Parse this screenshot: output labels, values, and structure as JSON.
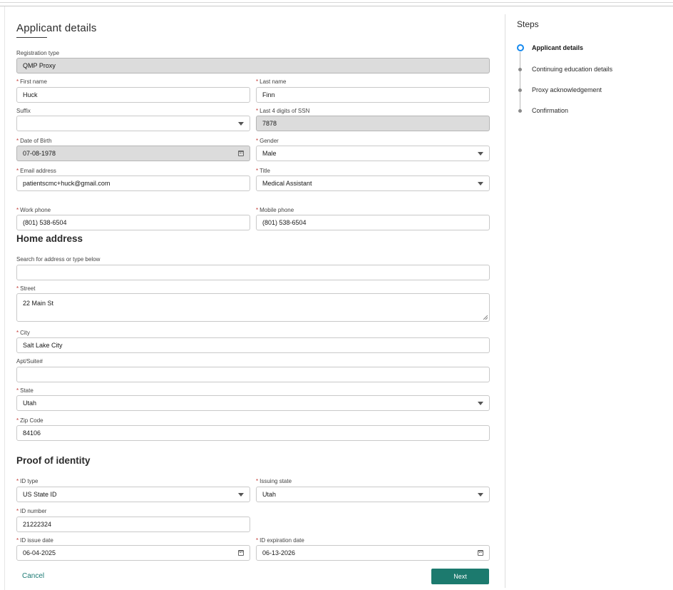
{
  "page": {
    "title": "Applicant details"
  },
  "form": {
    "registration_type": {
      "label": "Registration type",
      "value": "QMP Proxy"
    },
    "first_name": {
      "label": "First name",
      "value": "Huck"
    },
    "last_name": {
      "label": "Last name",
      "value": "Finn"
    },
    "suffix": {
      "label": "Suffix",
      "value": ""
    },
    "ssn_last4": {
      "label": "Last 4 digits of SSN",
      "value": "7878"
    },
    "dob": {
      "label": "Date of Birth",
      "value": "07-08-1978"
    },
    "gender": {
      "label": "Gender",
      "value": "Male"
    },
    "email": {
      "label": "Email address",
      "value": "patientscmc+huck@gmail.com"
    },
    "title_field": {
      "label": "Title",
      "value": "Medical Assistant"
    },
    "work_phone": {
      "label": "Work phone",
      "value": "(801) 538-6504"
    },
    "mobile_phone": {
      "label": "Mobile phone",
      "value": "(801) 538-6504"
    }
  },
  "home_address": {
    "heading": "Home address",
    "search": {
      "label": "Search for address or type below",
      "value": ""
    },
    "street": {
      "label": "Street",
      "value": "22 Main St"
    },
    "city": {
      "label": "City",
      "value": "Salt Lake City"
    },
    "apt": {
      "label": "Apt/Suite#",
      "value": ""
    },
    "state": {
      "label": "State",
      "value": "Utah"
    },
    "zip": {
      "label": "Zip Code",
      "value": "84106"
    }
  },
  "proof_of_identity": {
    "heading": "Proof of identity",
    "id_type": {
      "label": "ID type",
      "value": "US State ID"
    },
    "issuing_state": {
      "label": "Issuing state",
      "value": "Utah"
    },
    "id_number": {
      "label": "ID number",
      "value": "21222324"
    },
    "id_issue_date": {
      "label": "ID issue date",
      "value": "06-04-2025"
    },
    "id_expiration_date": {
      "label": "ID expiration date",
      "value": "06-13-2026"
    }
  },
  "actions": {
    "cancel": "Cancel",
    "next": "Next"
  },
  "steps": {
    "title": "Steps",
    "items": [
      {
        "label": "Applicant details",
        "state": "active"
      },
      {
        "label": "Continuing education details",
        "state": "pending"
      },
      {
        "label": "Proxy acknowledgement",
        "state": "pending"
      },
      {
        "label": "Confirmation",
        "state": "pending"
      }
    ]
  },
  "colors": {
    "accent": "#1c7a6e",
    "link": "#1b7a74",
    "required": "#c23934",
    "step_active": "#1589ee"
  }
}
